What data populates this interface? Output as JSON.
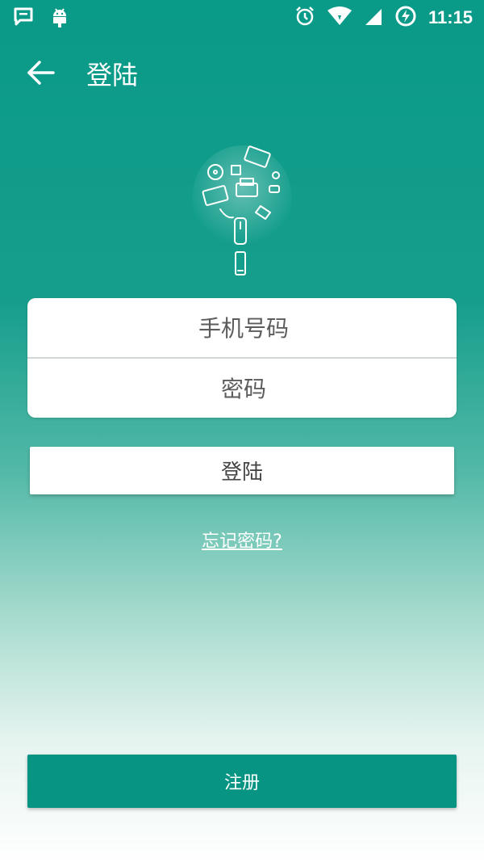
{
  "status_bar": {
    "time": "11:15",
    "icons": [
      "message-icon",
      "android-icon",
      "alarm-icon",
      "wifi-icon",
      "signal-icon",
      "battery-charging-icon"
    ]
  },
  "app_bar": {
    "back_icon": "arrow-left-icon",
    "title": "登陆"
  },
  "illustration": {
    "icon": "devices-bulb-illustration"
  },
  "form": {
    "phone_placeholder": "手机号码",
    "phone_value": "",
    "password_placeholder": "密码",
    "password_value": ""
  },
  "actions": {
    "login_label": "登陆",
    "forgot_label": "忘记密码?",
    "register_label": "注册"
  },
  "colors": {
    "primary": "#079483",
    "background_top": "#0a9a88",
    "background_bottom": "#ffffff"
  }
}
